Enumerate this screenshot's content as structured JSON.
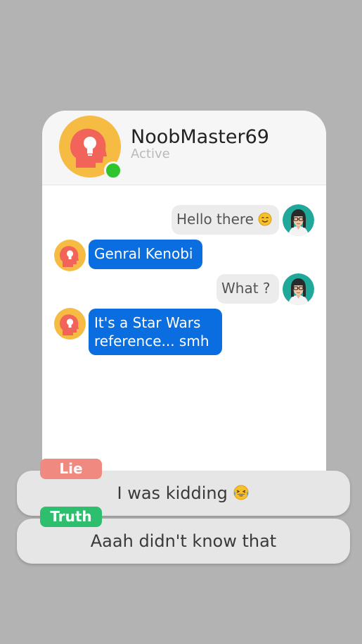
{
  "contact": {
    "name": "NoobMaster69",
    "status": "Active"
  },
  "messages": [
    {
      "sender": "self",
      "text": "Hello there",
      "emoji": "smiling-face-emoji"
    },
    {
      "sender": "contact",
      "text": "Genral Kenobi"
    },
    {
      "sender": "self",
      "text": "What ?"
    },
    {
      "sender": "contact",
      "line1": "It's a Star Wars",
      "line2": "reference... smh"
    }
  ],
  "choices": [
    {
      "tag": "Lie",
      "text": "I was kidding",
      "emoji": "tears-of-joy-emoji",
      "tag_color": "#f08a80"
    },
    {
      "tag": "Truth",
      "text": "Aaah didn't know that",
      "tag_color": "#2ebf6e"
    }
  ],
  "colors": {
    "background": "#b3b3b3",
    "contact_bubble": "#0a6ee0",
    "self_bubble": "#ececec",
    "online": "#2ec52e",
    "contact_avatar": "#f6bb43",
    "self_avatar": "#20a99a"
  },
  "icons": {
    "contact_avatar": "head-with-lightbulb-icon",
    "self_avatar": "woman-with-glasses-icon"
  }
}
